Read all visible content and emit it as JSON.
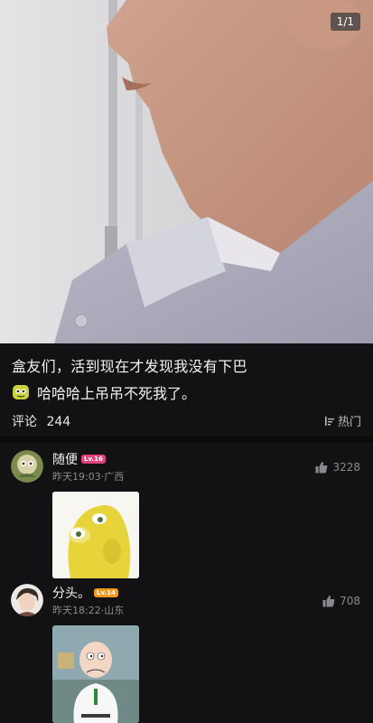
{
  "photo": {
    "counter": "1/1"
  },
  "post": {
    "title": "盒友们，活到现在才发现我没有下巴",
    "subtitle": "哈哈哈上吊吊不死我了。"
  },
  "comments_bar": {
    "label": "评论",
    "count": "244",
    "sort_label": "热门"
  },
  "comments": [
    {
      "username": "随便",
      "level": "Lv.16",
      "level_color": "#e8427e",
      "time": "昨天19:03",
      "location": "广西",
      "likes": "3228"
    },
    {
      "username": "分头。",
      "level": "Lv.14",
      "level_color": "#f39a1e",
      "time": "昨天18:22",
      "location": "山东",
      "likes": "708"
    }
  ],
  "icons": [
    "thumb-up-icon",
    "sort-icon",
    "laugh-emoji-icon"
  ]
}
